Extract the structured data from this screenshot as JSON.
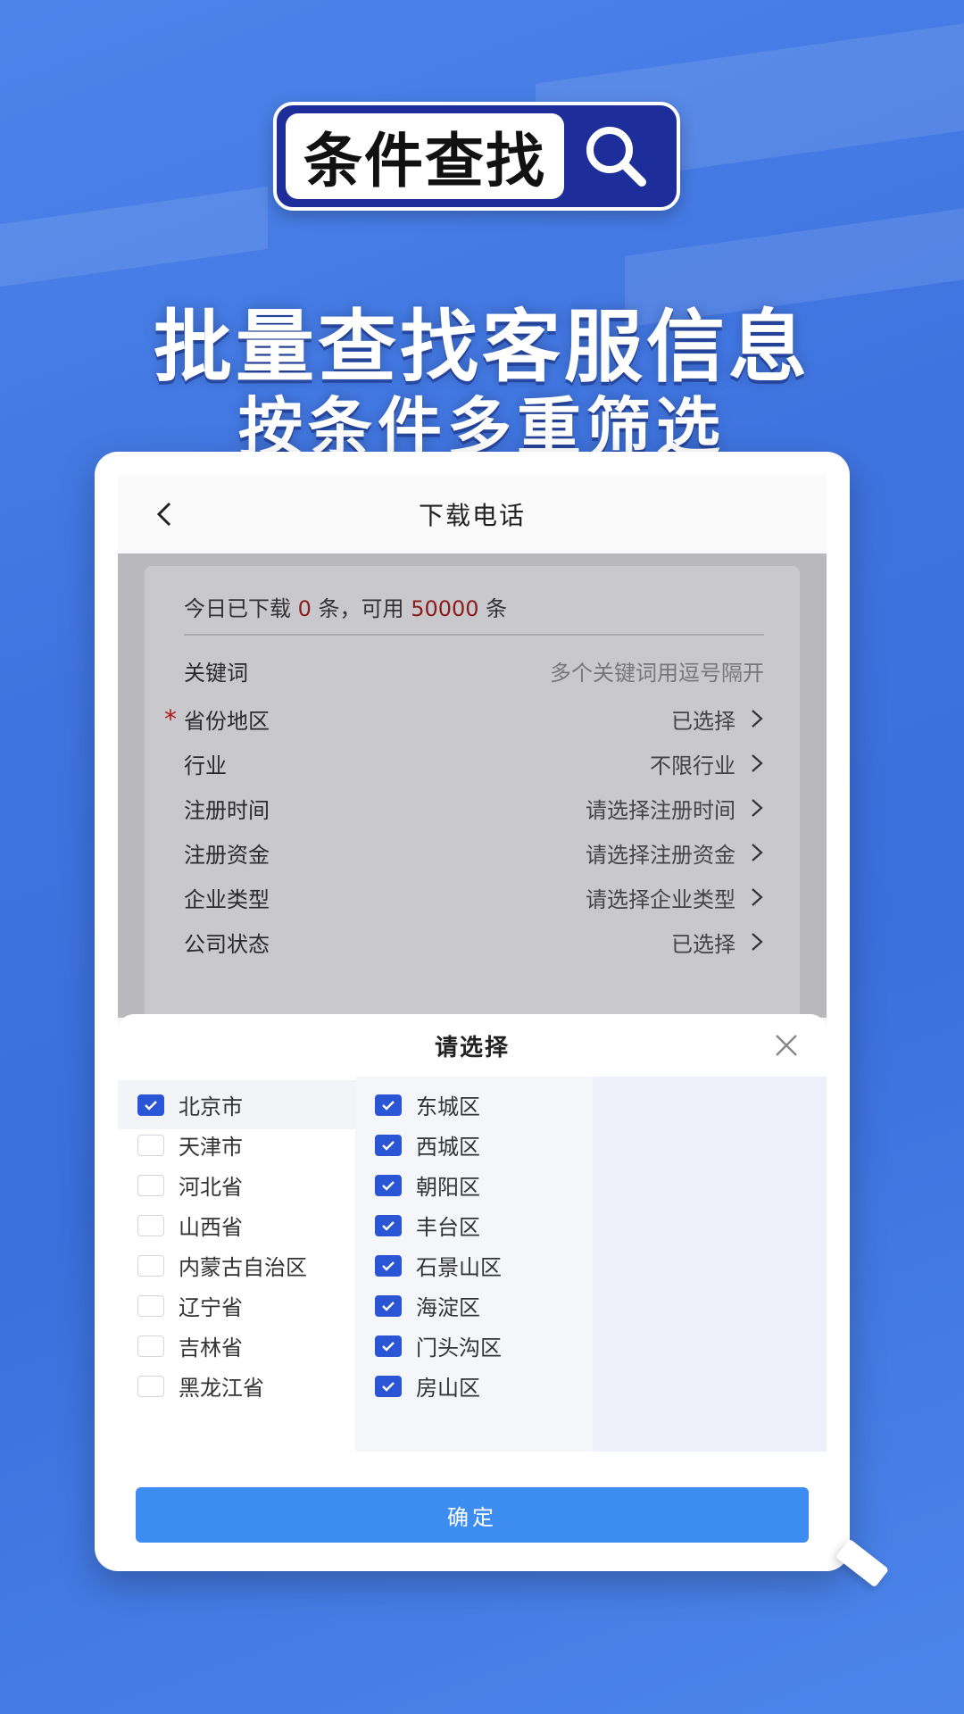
{
  "badge": {
    "text": "条件查找",
    "icon": "search-icon"
  },
  "headline": {
    "line1": "批量查找客服信息",
    "line2": "按条件多重筛选"
  },
  "nav": {
    "title": "下载电话",
    "back_icon": "chevron-left-icon"
  },
  "quota": {
    "prefix": "今日已下载 ",
    "downloaded": "0",
    "middle": " 条，可用 ",
    "available": "50000",
    "suffix": " 条"
  },
  "form": {
    "rows": [
      {
        "label": "关键词",
        "value": "多个关键词用逗号隔开",
        "required": false,
        "chevron": false
      },
      {
        "label": "省份地区",
        "value": "已选择",
        "required": true,
        "chevron": true
      },
      {
        "label": "行业",
        "value": "不限行业",
        "required": false,
        "chevron": true
      },
      {
        "label": "注册时间",
        "value": "请选择注册时间",
        "required": false,
        "chevron": true
      },
      {
        "label": "注册资金",
        "value": "请选择注册资金",
        "required": false,
        "chevron": true
      },
      {
        "label": "企业类型",
        "value": "请选择企业类型",
        "required": false,
        "chevron": true
      },
      {
        "label": "公司状态",
        "value": "已选择",
        "required": false,
        "chevron": true
      }
    ],
    "required_mark": "*"
  },
  "sheet": {
    "title": "请选择",
    "provinces": [
      {
        "name": "北京市",
        "checked": true
      },
      {
        "name": "天津市",
        "checked": false
      },
      {
        "name": "河北省",
        "checked": false
      },
      {
        "name": "山西省",
        "checked": false
      },
      {
        "name": "内蒙古自治区",
        "checked": false
      },
      {
        "name": "辽宁省",
        "checked": false
      },
      {
        "name": "吉林省",
        "checked": false
      },
      {
        "name": "黑龙江省",
        "checked": false
      }
    ],
    "districts": [
      {
        "name": "东城区",
        "checked": true
      },
      {
        "name": "西城区",
        "checked": true
      },
      {
        "name": "朝阳区",
        "checked": true
      },
      {
        "name": "丰台区",
        "checked": true
      },
      {
        "name": "石景山区",
        "checked": true
      },
      {
        "name": "海淀区",
        "checked": true
      },
      {
        "name": "门头沟区",
        "checked": true
      },
      {
        "name": "房山区",
        "checked": true
      }
    ],
    "confirm_label": "确定"
  },
  "colors": {
    "accent": "#2a56d6",
    "button": "#3d8cf2",
    "badge_bg": "#1d2e9a",
    "highlight_num": "#8b1c1c"
  }
}
